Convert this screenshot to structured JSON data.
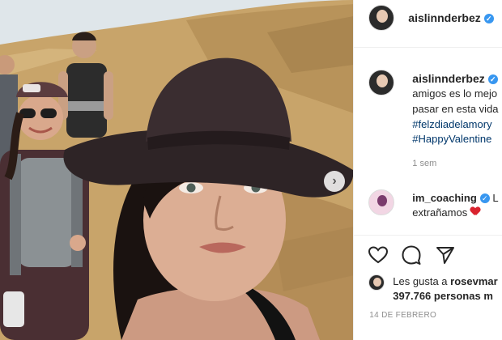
{
  "post": {
    "author": "aislinnderbez",
    "caption": {
      "username": "aislinnderbez",
      "line1": "amigos es lo mejo",
      "line2": "pasar en esta vida",
      "hashtag1": "#felzdiadelamory",
      "hashtag2": "#HappyValentine",
      "time": "1 sem"
    },
    "comment": {
      "username": "im_coaching",
      "text_after": "L",
      "line2": "extrañamos"
    },
    "likes": {
      "prefix": "Les gusta a",
      "user": "rosevmar",
      "count_line": "397.766 personas m"
    },
    "date": "14 DE FEBRERO",
    "icons": {
      "verified": "verified-badge-icon",
      "like": "heart-icon",
      "comment": "comment-icon",
      "share": "paper-plane-icon",
      "next": "chevron-right-icon"
    },
    "colors": {
      "verified": "#3897f0",
      "hashtag": "#00376b",
      "muted": "#8e8e8e"
    }
  }
}
